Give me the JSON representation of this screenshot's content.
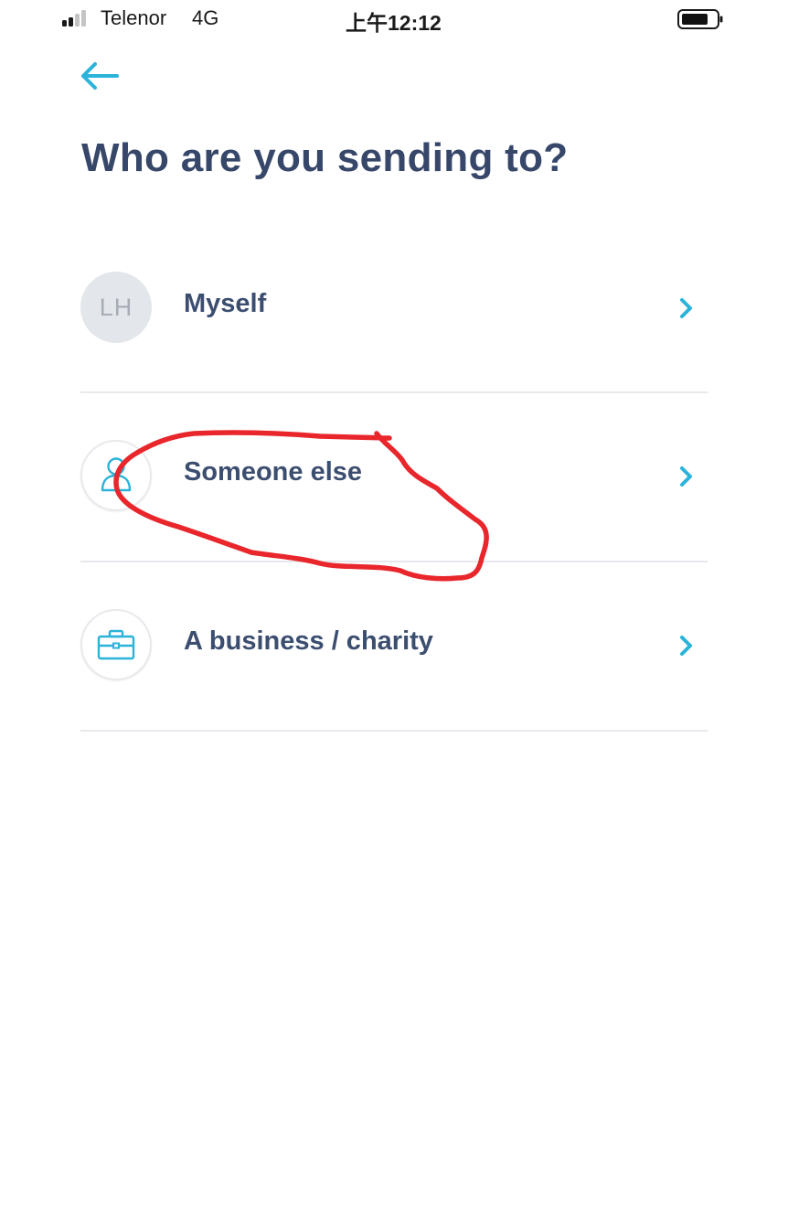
{
  "status_bar": {
    "carrier": "Telenor",
    "network": "4G",
    "time": "上午12:12",
    "signal_bars_active": 2,
    "signal_bars_total": 4
  },
  "header": {
    "back_icon": "arrow-left-icon",
    "title": "Who are you sending to?"
  },
  "options": [
    {
      "label": "Myself",
      "avatar_initials": "LH",
      "icon": "initials-avatar",
      "chevron_icon": "chevron-right-icon"
    },
    {
      "label": "Someone else",
      "icon": "person-icon",
      "chevron_icon": "chevron-right-icon"
    },
    {
      "label": "A business / charity",
      "icon": "briefcase-icon",
      "chevron_icon": "chevron-right-icon"
    }
  ],
  "annotation": {
    "type": "hand-drawn circle",
    "color": "#e8262b",
    "target": "Someone else"
  },
  "colors": {
    "accent": "#2bb3d9",
    "title": "#37476a",
    "label": "#3c4e70",
    "divider": "#e6e8ec",
    "avatar_bg": "#e3e6ea",
    "avatar_text": "#a7adb6"
  }
}
